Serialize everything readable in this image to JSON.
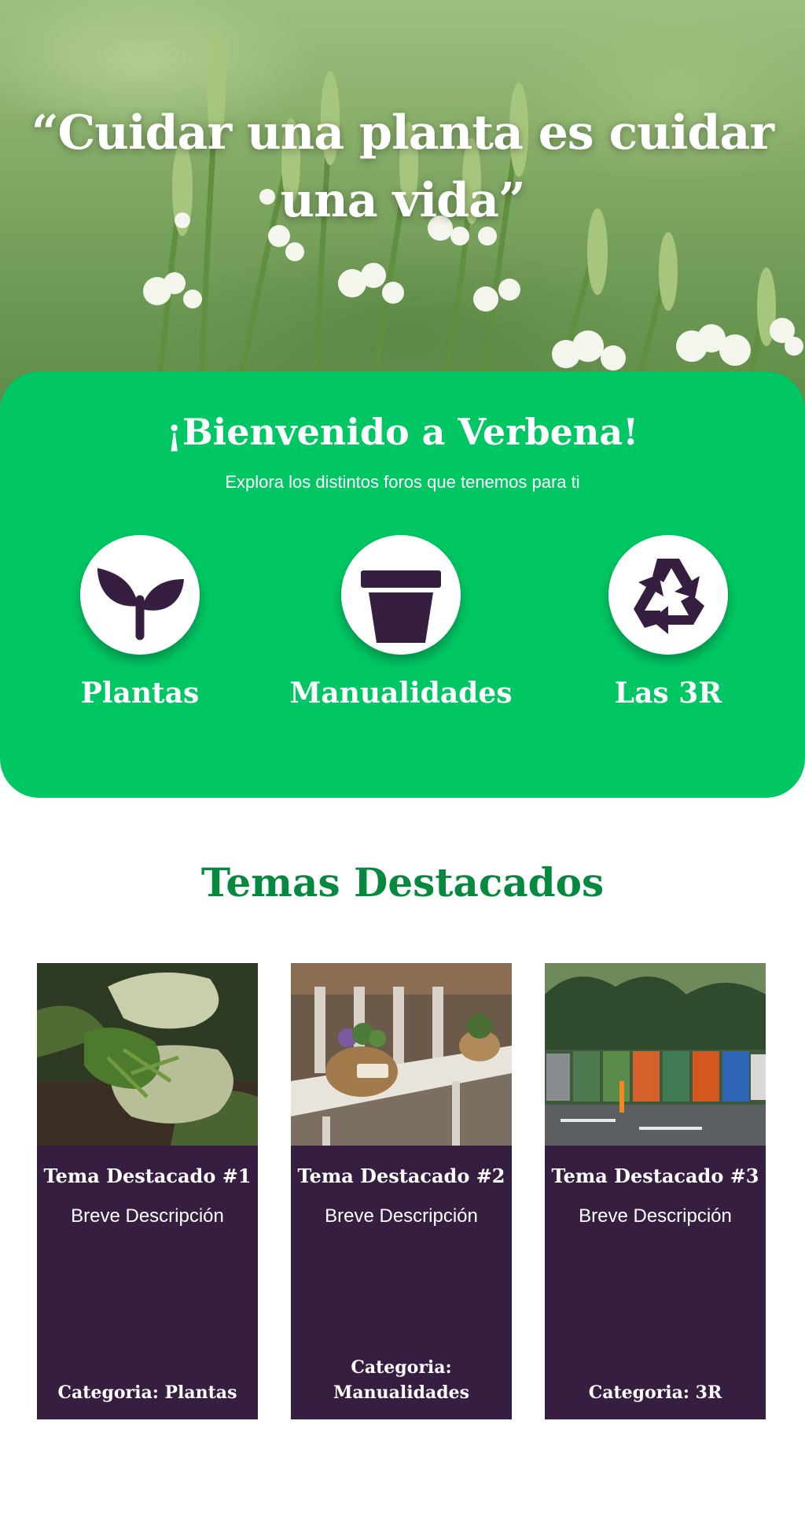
{
  "hero": {
    "quote": "“Cuidar una planta es cuidar una vida”"
  },
  "welcome": {
    "title": "¡Bienvenido a Verbena!",
    "subtitle": "Explora los distintos foros que tenemos para ti",
    "forums": [
      {
        "label": "Plantas",
        "icon": "sprout-icon"
      },
      {
        "label": "Manualidades",
        "icon": "flower-pot-icon"
      },
      {
        "label": "Las 3R",
        "icon": "recycle-icon"
      }
    ]
  },
  "featured": {
    "title": "Temas Destacados",
    "cards": [
      {
        "title": "Tema Destacado #1",
        "description": "Breve Descripción",
        "category": "Categoria: Plantas",
        "image": "gloved-hands-holding-weeds"
      },
      {
        "title": "Tema Destacado #2",
        "description": "Breve Descripción",
        "category": "Categoria: Manualidades",
        "image": "wicker-basket-planters-on-table"
      },
      {
        "title": "Tema Destacado #3",
        "description": "Breve Descripción",
        "category": "Categoria: 3R",
        "image": "colorful-recycling-bins"
      }
    ]
  },
  "colors": {
    "primary_green": "#00c764",
    "heading_green": "#05893f",
    "dark_purple": "#361e40",
    "white": "#ffffff"
  }
}
